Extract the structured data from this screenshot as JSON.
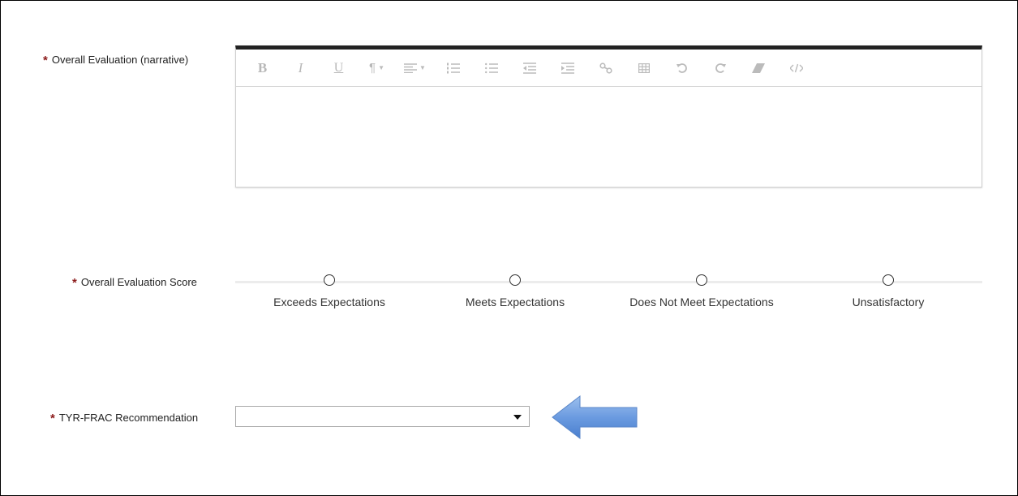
{
  "narrative": {
    "required_mark": "*",
    "label": "Overall Evaluation (narrative)",
    "toolbar": [
      {
        "name": "bold-icon"
      },
      {
        "name": "italic-icon"
      },
      {
        "name": "underline-icon"
      },
      {
        "name": "paragraph-style-icon"
      },
      {
        "name": "align-icon"
      },
      {
        "name": "ordered-list-icon"
      },
      {
        "name": "unordered-list-icon"
      },
      {
        "name": "outdent-icon"
      },
      {
        "name": "indent-icon"
      },
      {
        "name": "link-icon"
      },
      {
        "name": "table-icon"
      },
      {
        "name": "undo-icon"
      },
      {
        "name": "redo-icon"
      },
      {
        "name": "eraser-icon"
      },
      {
        "name": "code-view-icon"
      }
    ],
    "toolbar_glyphs": {
      "bold": "B",
      "italic": "I",
      "underline": "U",
      "paragraph": "¶"
    },
    "value": ""
  },
  "score": {
    "required_mark": "*",
    "label": "Overall Evaluation Score",
    "options": [
      {
        "label": "Exceeds Expectations",
        "selected": false
      },
      {
        "label": "Meets Expectations",
        "selected": false
      },
      {
        "label": "Does Not Meet Expectations",
        "selected": false
      },
      {
        "label": "Unsatisfactory",
        "selected": false
      }
    ]
  },
  "recommendation": {
    "required_mark": "*",
    "label": "TYR-FRAC Recommendation",
    "selected_value": ""
  },
  "colors": {
    "required": "#8b1a1a",
    "editor_top_border": "#222222",
    "arrow_fill": "#5b8fd6"
  }
}
